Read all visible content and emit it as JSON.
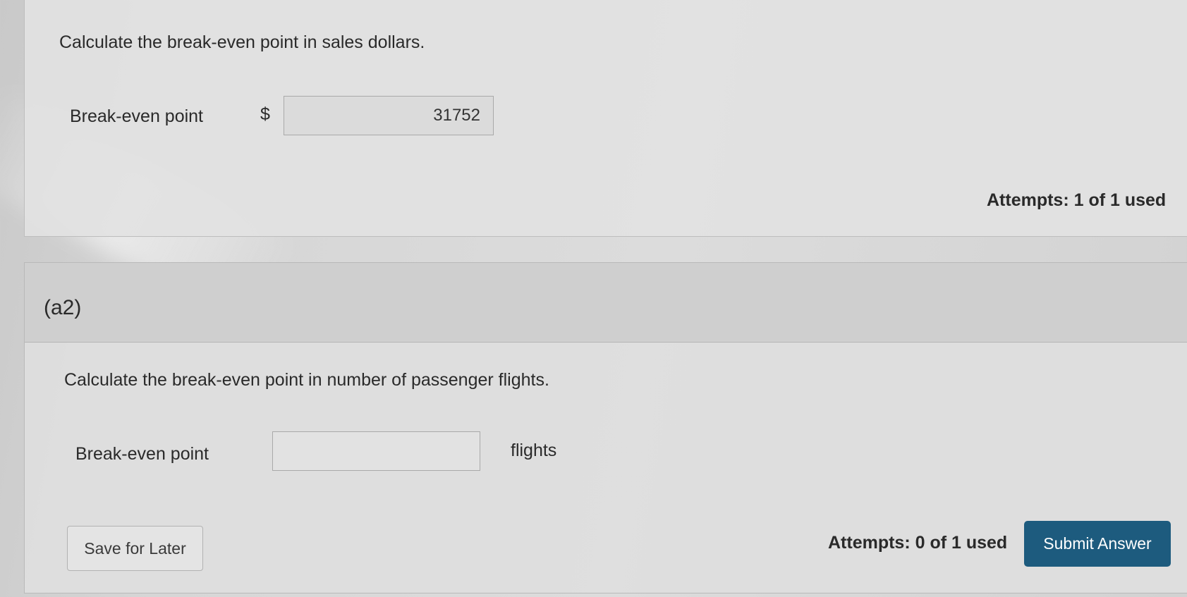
{
  "part_a1": {
    "question": "Calculate the break-even point in sales dollars.",
    "field_label": "Break-even point",
    "currency_symbol": "$",
    "answer_value": "31752",
    "attempts": "Attempts: 1 of 1 used"
  },
  "part_a2": {
    "label": "(a2)",
    "question": "Calculate the break-even point in number of passenger flights.",
    "field_label": "Break-even point",
    "answer_value": "",
    "unit": "flights",
    "save_label": "Save for Later",
    "attempts": "Attempts: 0 of 1 used",
    "submit_label": "Submit Answer"
  },
  "colors": {
    "submit_button": "#1d5b7e",
    "background": "#d6d6d6"
  }
}
